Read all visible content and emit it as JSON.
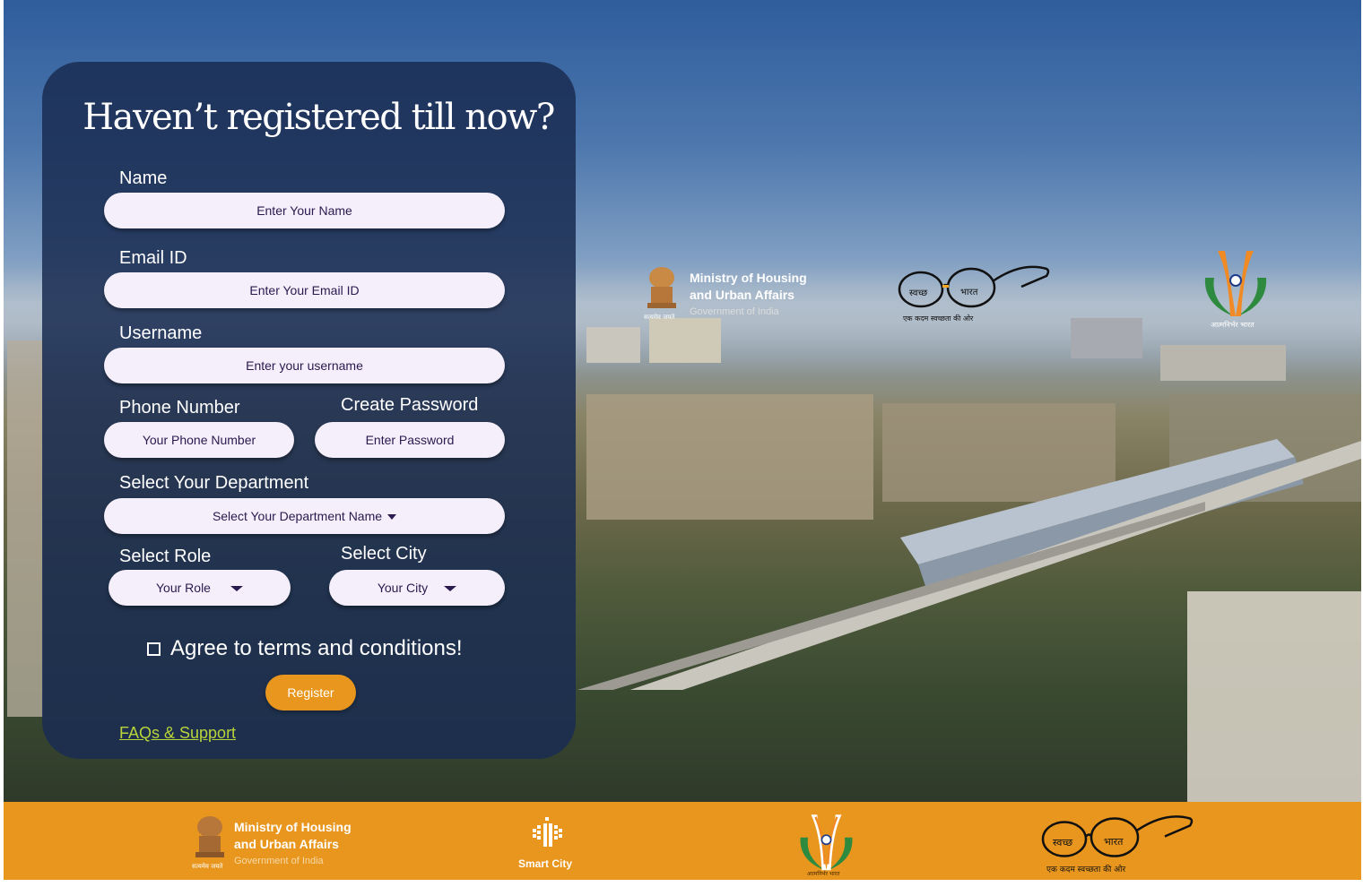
{
  "form": {
    "title": "Haven’t registered till now?",
    "name_label": "Name",
    "name_placeholder": "Enter Your Name",
    "email_label": "Email ID",
    "email_placeholder": "Enter Your Email ID",
    "username_label": "Username",
    "username_placeholder": "Enter your username",
    "phone_label": "Phone Number",
    "phone_placeholder": "Your Phone Number",
    "password_label": "Create Password",
    "password_placeholder": "Enter Password",
    "department_label": "Select Your Department",
    "department_value": "Select Your Department Name",
    "role_label": "Select Role",
    "role_value": "Your Role",
    "city_label": "Select City",
    "city_value": "Your City",
    "agree_label": "Agree to terms and conditions!",
    "register_label": "Register",
    "faq_link": "FAQs & Support"
  },
  "logos": {
    "mohua_line1": "Ministry of Housing",
    "mohua_line2": "and Urban Affairs",
    "mohua_line3": "Government of India",
    "emblem_motto": "सत्यमेव जयते",
    "swachh_left": "स्वच्छ",
    "swachh_right": "भारत",
    "swachh_tagline": "एक कदम स्वच्छता की ओर",
    "atmanirbhar": "आत्मनिर्भर भारत",
    "smart_city": "Smart City"
  },
  "colors": {
    "accent": "#e8961d",
    "panel": "#1a2c52",
    "link": "#b8d43a"
  }
}
